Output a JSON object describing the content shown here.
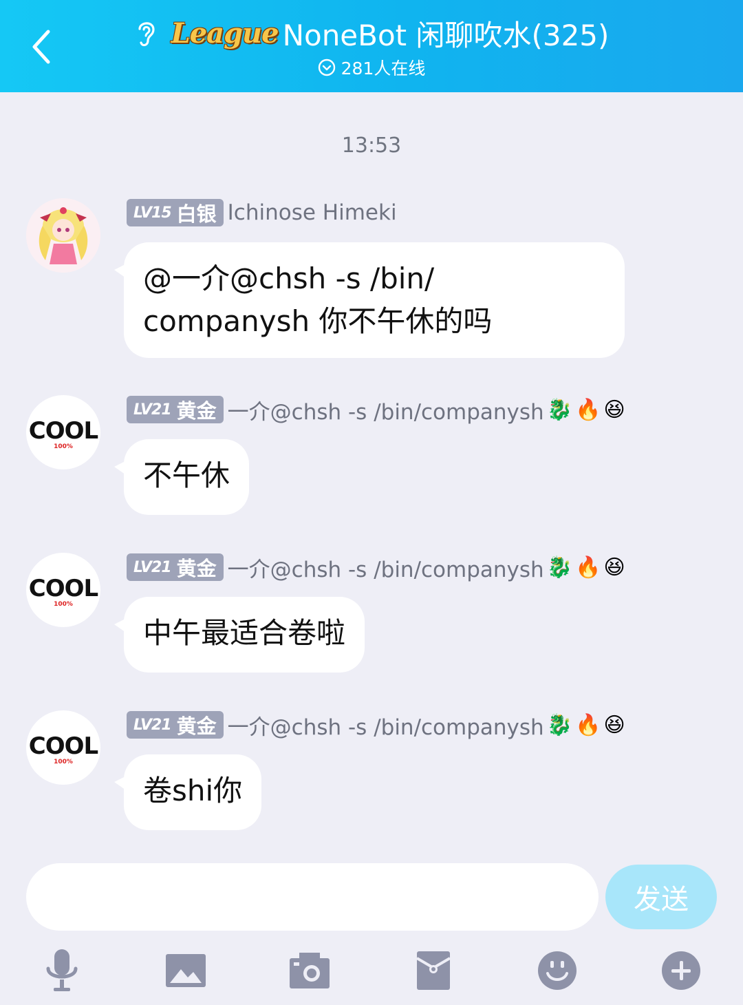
{
  "header": {
    "logo_text": "League",
    "group_name": "NoneBot 闲聊吹水(325)",
    "online": "281人在线"
  },
  "chat": {
    "timestamp": "13:53",
    "messages": [
      {
        "level": "LV15",
        "rank": "白银",
        "sender": "Ichinose Himeki",
        "text_lines": [
          "@一介@chsh -s /bin/",
          "companysh 你不午休的吗"
        ]
      },
      {
        "level": "LV21",
        "rank": "黄金",
        "sender": "一介@chsh -s /bin/companysh",
        "emojis": [
          "🐉",
          "🔥",
          "😆"
        ],
        "text": "不午休",
        "avatar_text": "COOL",
        "avatar_sub": "100%"
      },
      {
        "level": "LV21",
        "rank": "黄金",
        "sender": "一介@chsh -s /bin/companysh",
        "emojis": [
          "🐉",
          "🔥",
          "😆"
        ],
        "text": "中午最适合卷啦",
        "avatar_text": "COOL",
        "avatar_sub": "100%"
      },
      {
        "level": "LV21",
        "rank": "黄金",
        "sender": "一介@chsh -s /bin/companysh",
        "emojis": [
          "🐉",
          "🔥",
          "😆"
        ],
        "text": "卷shi你",
        "avatar_text": "COOL",
        "avatar_sub": "100%"
      }
    ]
  },
  "input": {
    "value": "",
    "send_label": "发送"
  },
  "toolbar": {
    "icons": [
      "microphone-icon",
      "image-icon",
      "camera-icon",
      "red-packet-icon",
      "emoji-icon",
      "plus-icon"
    ]
  },
  "colors": {
    "header_start": "#15c8f5",
    "header_end": "#1aa8ee",
    "background": "#eeeef6",
    "badge": "#9ea3b8",
    "send_button": "#a8e6fa",
    "toolbar_icon": "#8e92a8"
  }
}
